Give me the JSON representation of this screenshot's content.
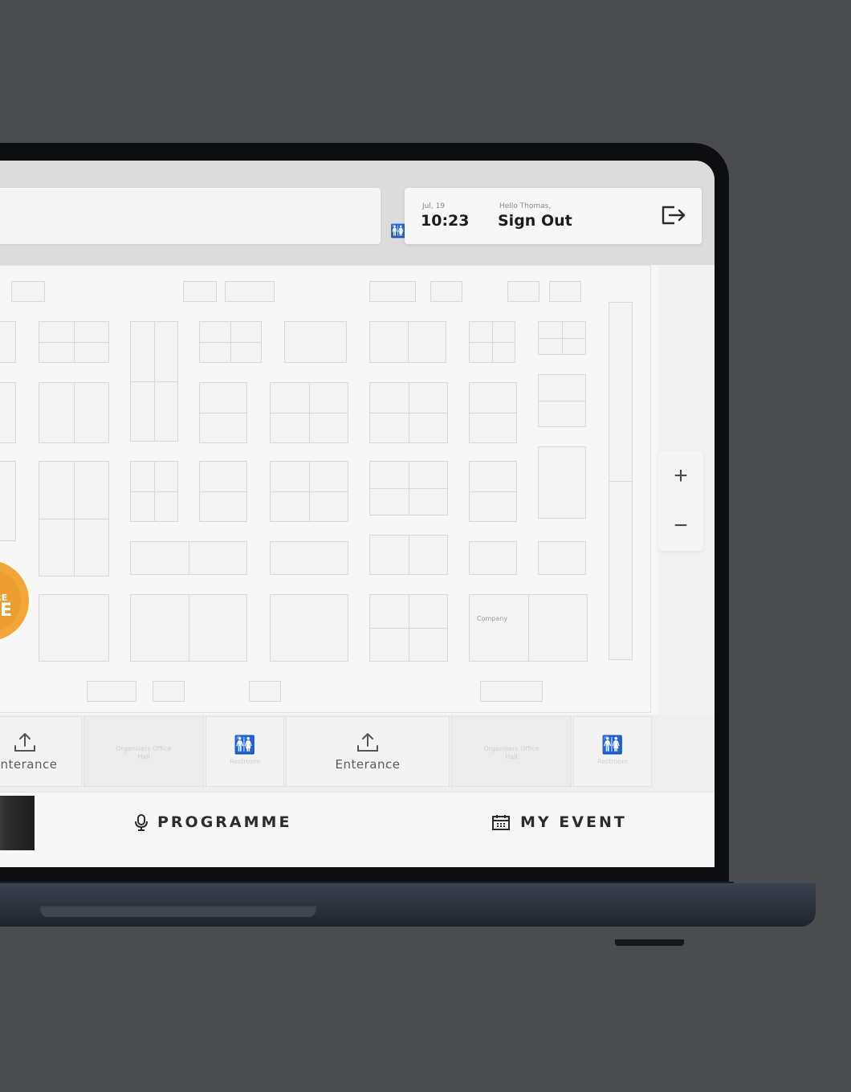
{
  "header": {
    "date": "Jul, 19",
    "time": "10:23",
    "greeting": "Hello Thomas,",
    "signout_label": "Sign Out",
    "logout_icon": "logout-icon"
  },
  "map": {
    "company_label": "Company",
    "pin_line1": "U ARE",
    "pin_line2": "ERE",
    "zoom_in": "+",
    "zoom_out": "−"
  },
  "bottom_cells": {
    "entrance_left": "Enterance",
    "office_1": "Organisers Office Hall",
    "restroom_1": "Restroom",
    "entrance_mid": "Enterance",
    "office_2": "Organisers Office Hall",
    "restroom_2": "Restroom"
  },
  "nav": {
    "programme_label": "PROGRAMME",
    "my_event_label": "MY EVENT",
    "programme_icon": "microphone-icon",
    "my_event_icon": "calendar-icon"
  },
  "colors": {
    "accent": "#f0a638",
    "background": "#4b4c50",
    "screen": "#f2f2f2"
  }
}
